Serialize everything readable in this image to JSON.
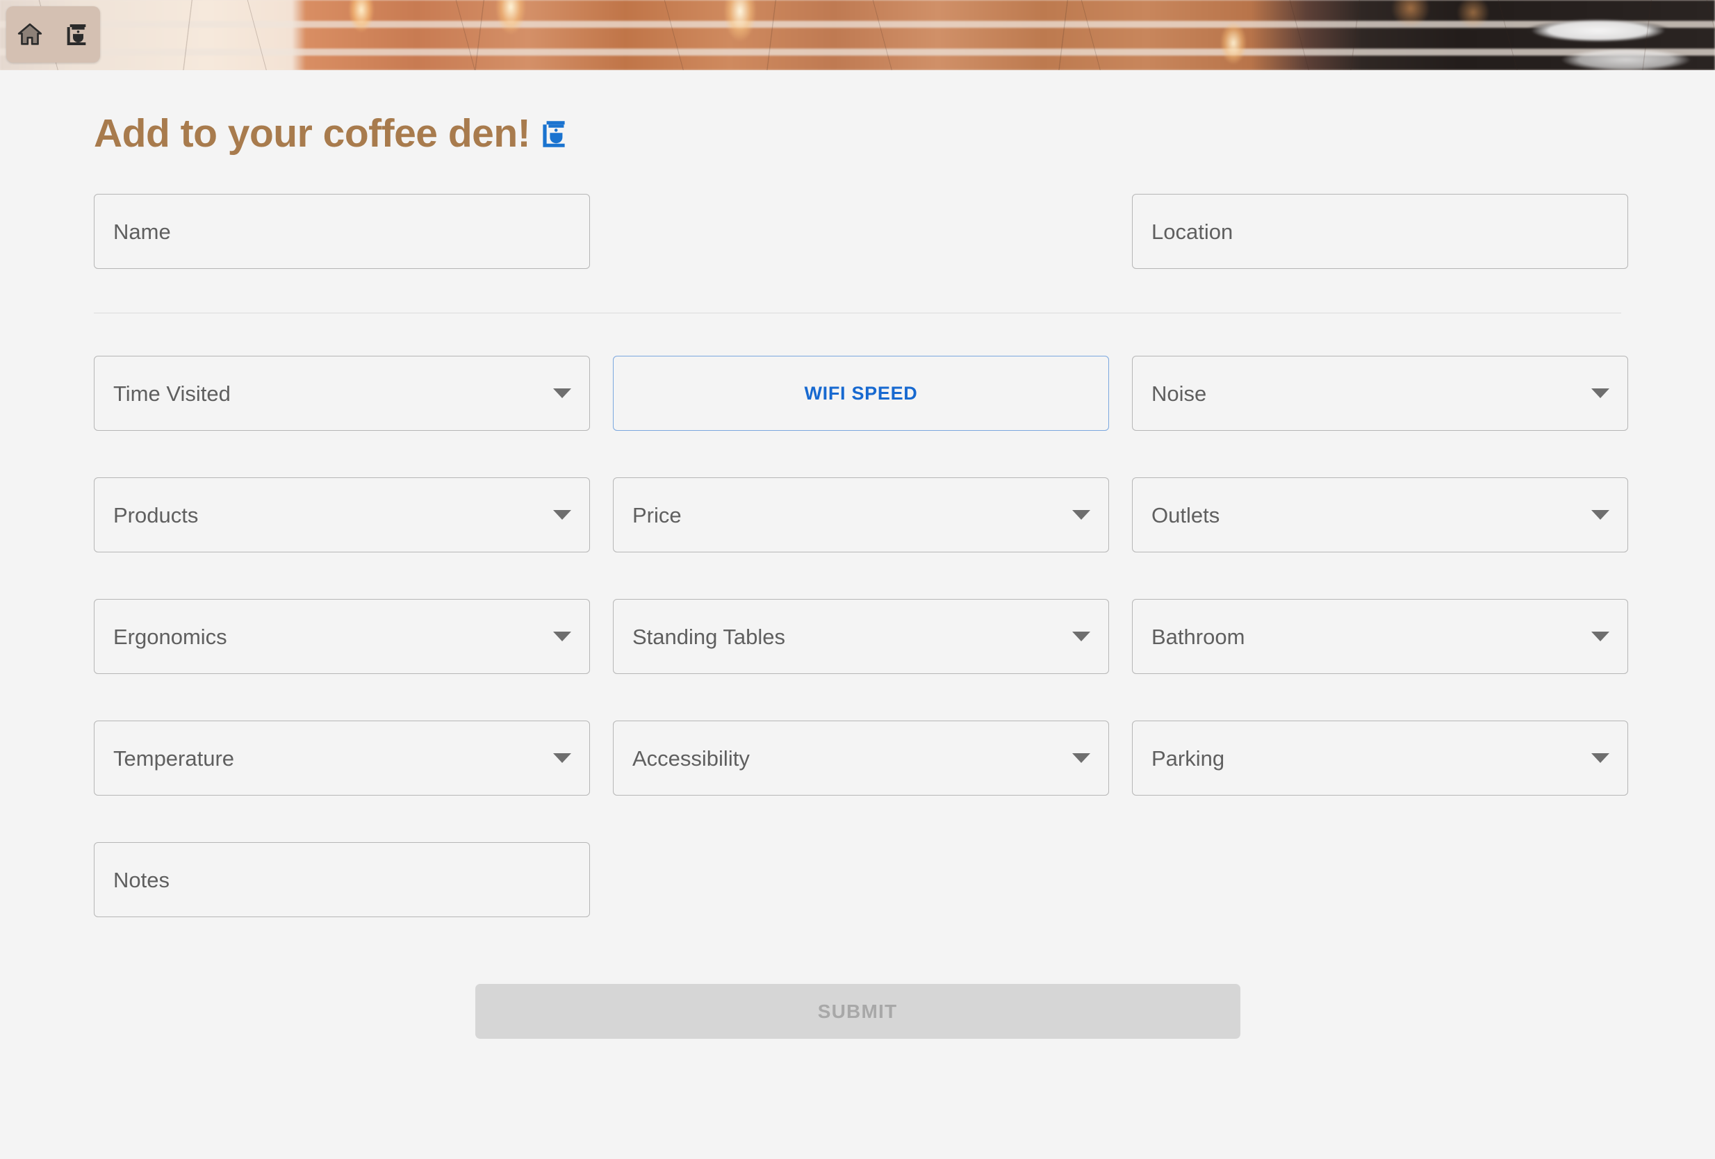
{
  "nav": {
    "home_icon": "home-icon",
    "coffee_icon": "coffee-maker-icon"
  },
  "header": {
    "title": "Add to your coffee den!",
    "title_emoji": "coffee-maker-emoji",
    "accent_color": "#a87b4d"
  },
  "form": {
    "identity_row": [
      {
        "label": "Name",
        "type": "text"
      },
      {
        "label": "Location",
        "type": "text"
      }
    ],
    "rows": [
      [
        {
          "label": "Time Visited",
          "type": "select"
        },
        {
          "label": "WIFI SPEED",
          "type": "button",
          "accent": true
        },
        {
          "label": "Noise",
          "type": "select"
        }
      ],
      [
        {
          "label": "Products",
          "type": "select"
        },
        {
          "label": "Price",
          "type": "select"
        },
        {
          "label": "Outlets",
          "type": "select"
        }
      ],
      [
        {
          "label": "Ergonomics",
          "type": "select"
        },
        {
          "label": "Standing Tables",
          "type": "select"
        },
        {
          "label": "Bathroom",
          "type": "select"
        }
      ],
      [
        {
          "label": "Temperature",
          "type": "select"
        },
        {
          "label": "Accessibility",
          "type": "select"
        },
        {
          "label": "Parking",
          "type": "select"
        }
      ],
      [
        {
          "label": "Notes",
          "type": "text"
        }
      ]
    ],
    "submit": {
      "label": "SUBMIT",
      "disabled": true
    }
  },
  "colors": {
    "page_background": "#f4f4f4",
    "title": "#a87b4d",
    "accent_blue": "#1769d0",
    "accent_blue_border": "#7ba7de",
    "field_border": "#b6b6b6",
    "field_text": "#5f5f5f",
    "submit_background": "#d6d6d6",
    "submit_text": "#a8a8a8",
    "nav_pill": "#d4c0b2"
  }
}
